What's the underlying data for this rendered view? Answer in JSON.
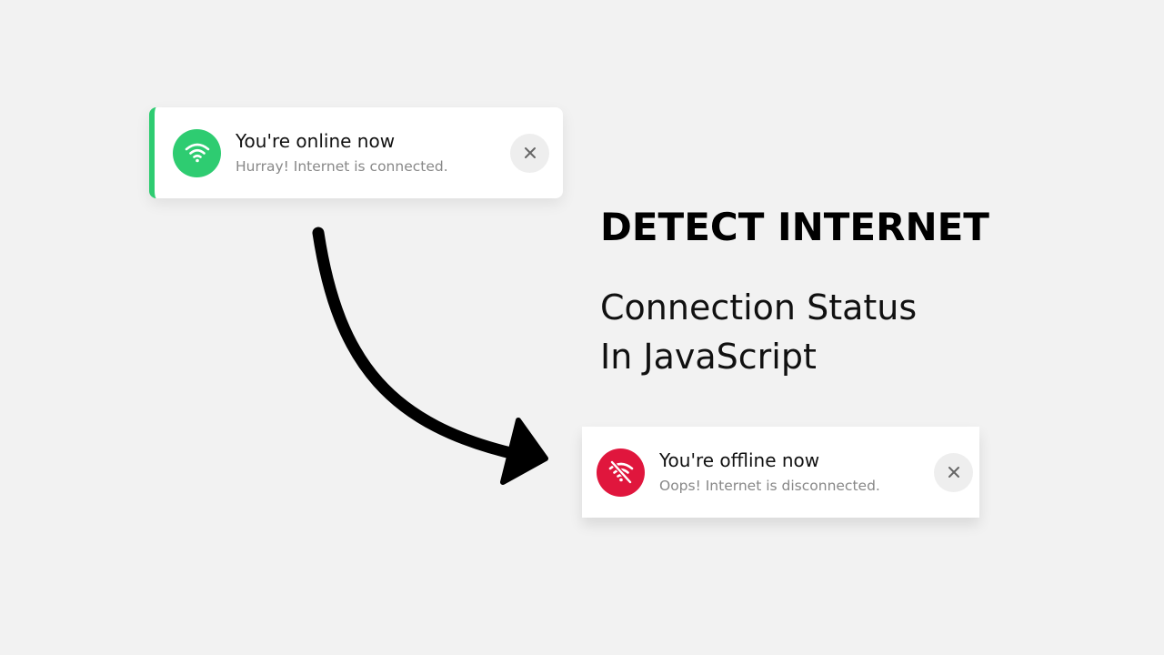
{
  "online_toast": {
    "title": "You're online now",
    "detail": "Hurray! Internet is connected.",
    "accent_color": "#2ecc71",
    "icon": "wifi-icon",
    "close_icon": "close-icon"
  },
  "offline_toast": {
    "title": "You're offline now",
    "detail": "Oops! Internet is disconnected.",
    "accent_color": "#e0163d",
    "icon": "wifi-off-icon",
    "close_icon": "close-icon"
  },
  "heading": {
    "title": "DETECT INTERNET",
    "line1": "Connection Status",
    "line2": "In JavaScript"
  },
  "colors": {
    "background": "#f2f2f2",
    "arrow": "#000000"
  }
}
